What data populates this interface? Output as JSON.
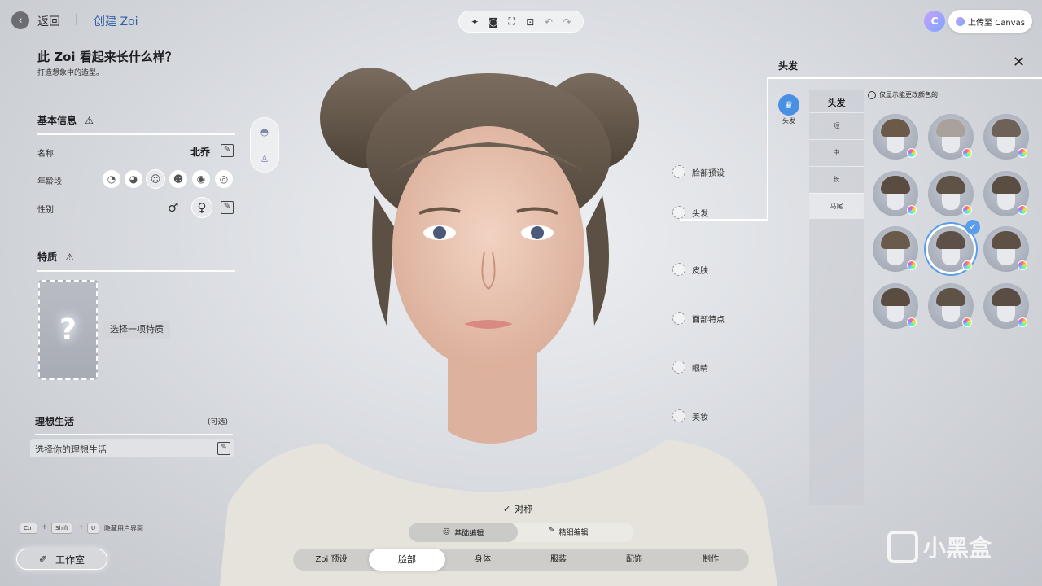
{
  "topbar": {
    "back_label": "返回",
    "separator": "|",
    "breadcrumb": "创建 Zoi",
    "upload_label": "上传至 Canvas"
  },
  "left": {
    "title": "此 Zoi 看起来长什么样？",
    "subtitle": "打造想象中的造型。",
    "basic_info": {
      "heading": "基本信息",
      "name_label": "名称",
      "name_value": "北乔",
      "age_label": "年龄段",
      "gender_label": "性别"
    },
    "traits": {
      "heading": "特质",
      "placeholder": "选择一项特质"
    },
    "ideal_life": {
      "heading": "理想生活",
      "optional": "(可选)",
      "placeholder": "选择你的理想生活"
    },
    "shortcut": {
      "keys": [
        "Ctrl",
        "Shift",
        "U"
      ],
      "label": "隐藏用户界面"
    },
    "studio_label": "工作室"
  },
  "regions": [
    "脸部预设",
    "头发",
    "皮肤",
    "面部特点",
    "眼睛",
    "美妆"
  ],
  "hair_panel": {
    "title": "头发",
    "category_label": "头发",
    "sub_heading": "头发",
    "sub_items": [
      "短",
      "中",
      "长",
      "马尾"
    ],
    "selected_sub": "马尾",
    "filter_label": "仅显示能更改颜色的",
    "items": [
      {
        "color": "#6b5a48"
      },
      {
        "color": "#a8a29a"
      },
      {
        "color": "#6e6258"
      },
      {
        "color": "#5a4c40"
      },
      {
        "color": "#5f5246"
      },
      {
        "color": "#5a4d42"
      },
      {
        "color": "#6a5a4a"
      },
      {
        "color": "#5c5048",
        "selected": true
      },
      {
        "color": "#5e5044"
      },
      {
        "color": "#5a4c40"
      },
      {
        "color": "#5f5347"
      },
      {
        "color": "#5a4e44"
      }
    ]
  },
  "bottom": {
    "symmetry": "对称",
    "edit_basic": "基础编辑",
    "edit_fine": "精细编辑",
    "tabs": [
      "Zoi 预设",
      "脸部",
      "身体",
      "服装",
      "配饰",
      "制作"
    ],
    "selected_tab": "脸部"
  },
  "watermark": "小黑盒",
  "colors": {
    "accent": "#4a90e2",
    "selected_ring": "#5b9de8"
  }
}
